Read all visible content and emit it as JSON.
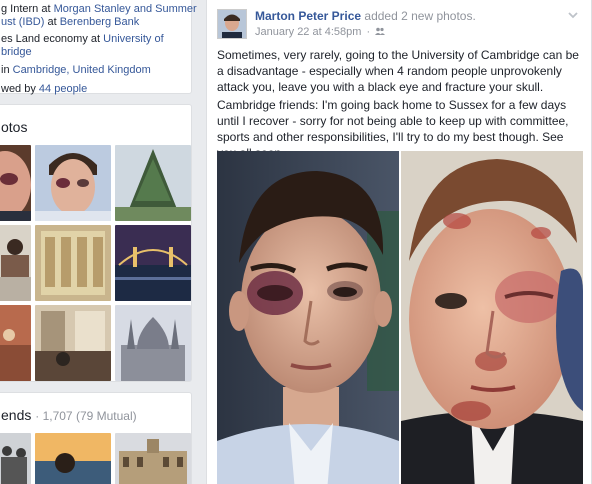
{
  "intro": {
    "line1_prefix": "g Intern at",
    "line1_link": "Morgan Stanley and Summer",
    "line2_link1": "ust (IBD)",
    "line2_mid": "at",
    "line2_link2": "Berenberg Bank",
    "line3_prefix": "es Land economy at",
    "line3_link": "University of",
    "line4_link": "bridge",
    "line5_prefix": "in",
    "line5_link": "Cambridge, United Kingdom",
    "line6_prefix": "wed by",
    "line6_link": "44 people"
  },
  "photos_section": {
    "title": "otos"
  },
  "friends_section": {
    "title": "ends",
    "count": "· 1,707 (79 Mutual)"
  },
  "post": {
    "author": "Marton Peter Price",
    "action": "added 2 new photos.",
    "timestamp": "January 22 at 4:58pm",
    "separator": "·",
    "paragraph1": "Sometimes, very rarely, going to the University of Cambridge can be a disadvantage - especially when 4 random people unprovokenly attack you, leave you with a black eye and fracture your skull.",
    "paragraph2": "Cambridge friends: I'm going back home to Sussex for a few days until I recover - sorry for not being able to keep up with committee, sports and other responsibilities, I'll try to do my best though. See you all soon."
  },
  "colors": {
    "link": "#365899",
    "meta": "#90949c",
    "page_bg": "#e9ebee"
  },
  "icons": [
    "audience-friends-icon",
    "chevron-down-icon"
  ]
}
